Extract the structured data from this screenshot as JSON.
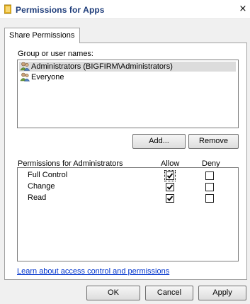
{
  "window": {
    "title": "Permissions for Apps",
    "close_glyph": "×"
  },
  "tabs": [
    {
      "label": "Share Permissions",
      "selected": true
    }
  ],
  "group_section": {
    "label": "Group or user names:",
    "users": [
      {
        "name": "Administrators (BIGFIRM\\Administrators)",
        "icon": "user-group-icon",
        "selected": true
      },
      {
        "name": "Everyone",
        "icon": "user-group-icon",
        "selected": false
      }
    ],
    "add_label": "Add...",
    "remove_label": "Remove"
  },
  "permissions_section": {
    "label": "Permissions for Administrators",
    "allow_header": "Allow",
    "deny_header": "Deny",
    "rows": [
      {
        "name": "Full Control",
        "allow": true,
        "deny": false
      },
      {
        "name": "Change",
        "allow": true,
        "deny": false
      },
      {
        "name": "Read",
        "allow": true,
        "deny": false
      }
    ]
  },
  "help_link": "Learn about access control and permissions",
  "footer": {
    "ok_label": "OK",
    "cancel_label": "Cancel",
    "apply_label": "Apply"
  },
  "colors": {
    "title_text": "#1f3d7a",
    "link": "#0033cc",
    "selection": "#dcdcdc"
  }
}
